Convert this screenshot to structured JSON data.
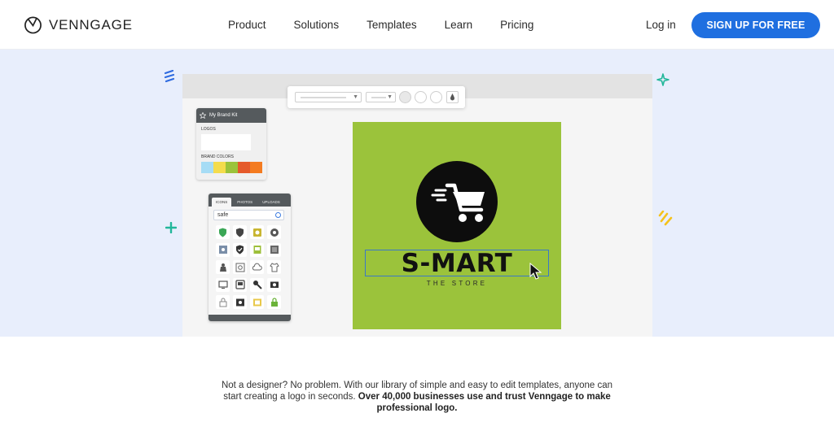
{
  "header": {
    "brand": "VENNGAGE",
    "nav": [
      "Product",
      "Solutions",
      "Templates",
      "Learn",
      "Pricing"
    ],
    "login": "Log in",
    "signup": "SIGN UP FOR FREE"
  },
  "brand_kit": {
    "title": "My Brand Kit",
    "logos_label": "LOGOS",
    "colors_label": "BRAND COLORS",
    "colors": [
      "#a6dcf5",
      "#f4dc4c",
      "#9bc33b",
      "#e55a2b",
      "#f47b20"
    ]
  },
  "icons_panel": {
    "tabs": [
      "ICONS",
      "PHOTOS",
      "UPLOADS"
    ],
    "search_value": "safe"
  },
  "canvas": {
    "title": "S-MART",
    "subtitle": "THE STORE",
    "background": "#9bc33b"
  },
  "description": {
    "text": "Not a designer? No problem. With our library of simple and easy to edit templates, anyone can start creating a logo in seconds. ",
    "bold": "Over 40,000 businesses use and trust Venngage to make professional logo."
  },
  "colors": {
    "accent": "#1f6fe0",
    "hero_bg": "#e8eefc"
  }
}
